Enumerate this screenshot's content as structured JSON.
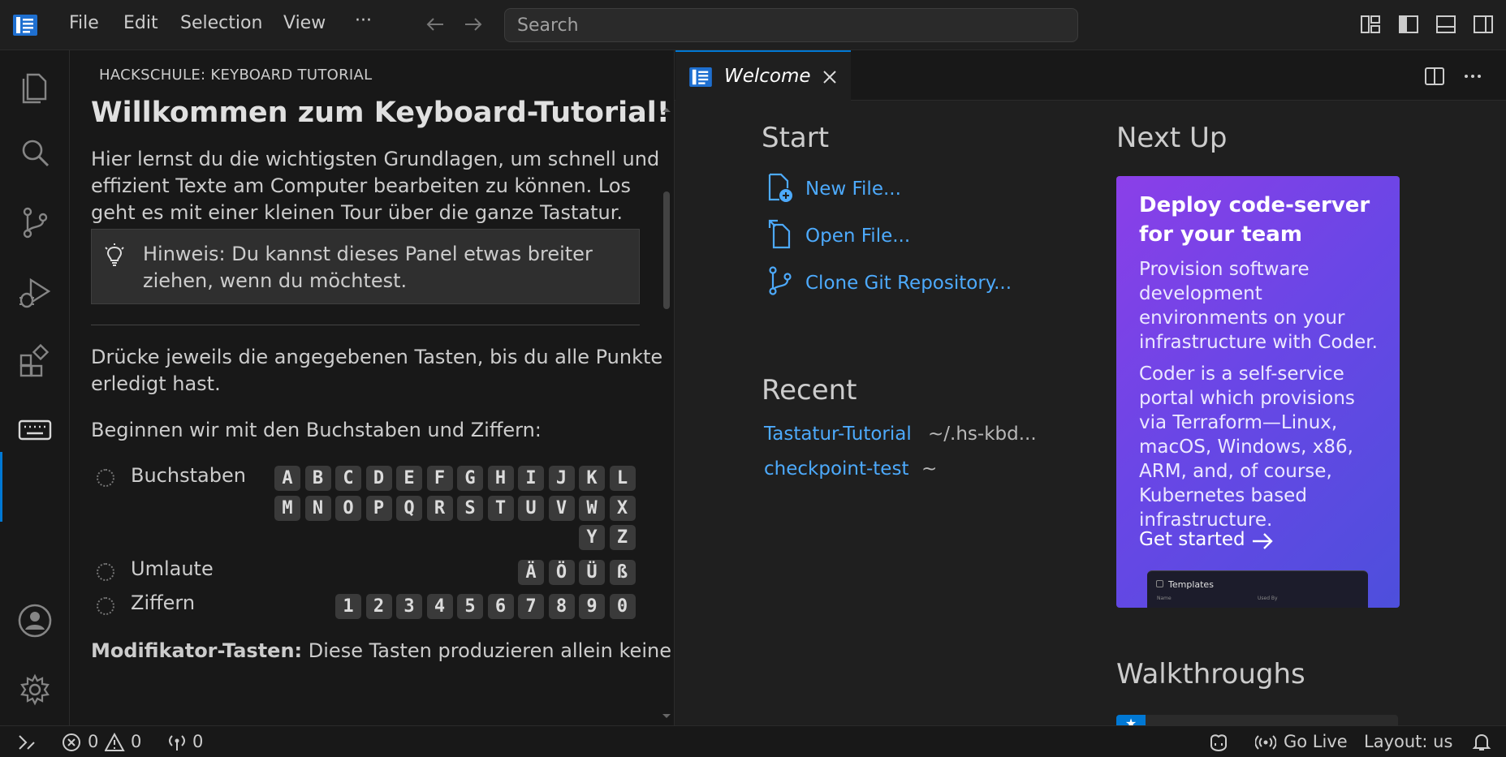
{
  "titlebar": {
    "menu": [
      "File",
      "Edit",
      "Selection",
      "View",
      "···"
    ],
    "search_placeholder": "Search"
  },
  "activity": {
    "icons": [
      "explorer-icon",
      "search-icon",
      "source-control-icon",
      "run-debug-icon",
      "extensions-icon",
      "keyboard-icon",
      "account-icon",
      "settings-gear-icon"
    ],
    "active": "keyboard-icon"
  },
  "sidepanel": {
    "title": "HACKSCHULE: KEYBOARD TUTORIAL",
    "heading": "Willkommen zum Keyboard-Tutorial!",
    "intro_lines": [
      "Hier lernst du die wichtigsten Grundlagen, um schnell und",
      "effizient Texte am Computer bearbeiten zu können. Los",
      "geht es mit einer kleinen Tour über die ganze Tastatur."
    ],
    "hint_lines": [
      "Hinweis: Du kannst dieses Panel etwas breiter",
      "ziehen, wenn du möchtest."
    ],
    "instruction_lines": [
      "Drücke jeweils die angegebenen Tasten, bis du alle Punkte",
      "erledigt hast."
    ],
    "begin_text": "Beginnen wir mit den Buchstaben und Ziffern:",
    "groups": {
      "letters": {
        "label": "Buchstaben",
        "row1": [
          "A",
          "B",
          "C",
          "D",
          "E",
          "F",
          "G",
          "H",
          "I",
          "J",
          "K",
          "L"
        ],
        "row2": [
          "M",
          "N",
          "O",
          "P",
          "Q",
          "R",
          "S",
          "T",
          "U",
          "V",
          "W",
          "X"
        ],
        "row3": [
          "Y",
          "Z"
        ]
      },
      "umlauts": {
        "label": "Umlaute",
        "keys": [
          "Ä",
          "Ö",
          "Ü",
          "ß"
        ]
      },
      "digits": {
        "label": "Ziffern",
        "keys": [
          "1",
          "2",
          "3",
          "4",
          "5",
          "6",
          "7",
          "8",
          "9",
          "0"
        ]
      }
    },
    "modifier_bold": "Modifikator-Tasten:",
    "modifier_text": " Diese Tasten produzieren allein keine"
  },
  "editor": {
    "tab_label": "Welcome",
    "start": {
      "title": "Start",
      "items": [
        "New File...",
        "Open File...",
        "Clone Git Repository..."
      ]
    },
    "recent": {
      "title": "Recent",
      "items": [
        {
          "name": "Tastatur-Tutorial",
          "path": "~/.hs-kbd..."
        },
        {
          "name": "checkpoint-test",
          "path": "~"
        }
      ]
    },
    "next_up": {
      "title": "Next Up",
      "card_title": "Deploy code-server for your team",
      "card_p1": "Provision software development environments on your infrastructure with Coder.",
      "card_p2": "Coder is a self-service portal which provisions via Terraform—Linux, macOS, Windows, x86, ARM, and, of course, Kubernetes based infrastructure.",
      "cta": "Get started",
      "preview_title": "Templates",
      "preview_col1": "Name",
      "preview_col2": "Used By"
    },
    "walkthroughs": {
      "title": "Walkthroughs"
    }
  },
  "statusbar": {
    "errors": "0",
    "warnings": "0",
    "ports": "0",
    "go_live": "Go Live",
    "layout": "Layout: us"
  },
  "colors": {
    "accent": "#0078d4",
    "link": "#4daafc",
    "card_gradient_start": "#8b3fe8",
    "card_gradient_end": "#4d4fdc"
  }
}
